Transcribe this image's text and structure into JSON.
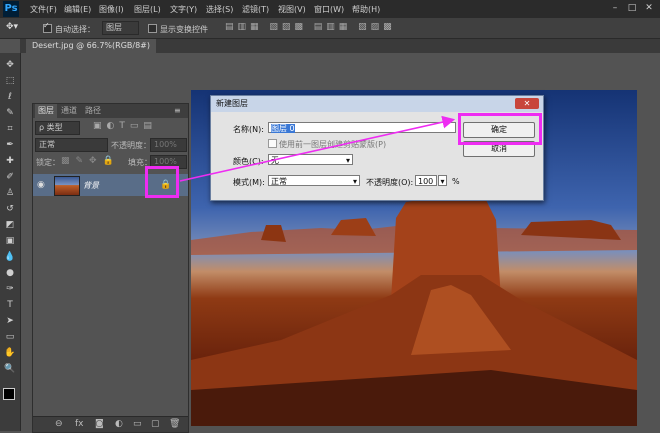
{
  "app": {
    "logo": "Ps"
  },
  "menu": [
    "文件(F)",
    "编辑(E)",
    "图像(I)",
    "图层(L)",
    "文字(Y)",
    "选择(S)",
    "滤镜(T)",
    "视图(V)",
    "窗口(W)",
    "帮助(H)"
  ],
  "options_bar": {
    "auto_select_label": "自动选择：",
    "auto_select_value": "图层",
    "show_transform_label": "显示变换控件"
  },
  "document": {
    "tab": "Desert.jpg @ 66.7%(RGB/8#)"
  },
  "layers_panel": {
    "tabs": [
      "图层",
      "通道",
      "路径"
    ],
    "kind_filter": "ρ 类型",
    "blend_mode": "正常",
    "opacity_label": "不透明度：",
    "opacity_value": "100%",
    "lock_label": "锁定：",
    "fill_label": "填充：",
    "fill_value": "100%",
    "layer_name": "背景"
  },
  "dialog": {
    "title": "新建图层",
    "name_label": "名称(N):",
    "name_value": "图层 0",
    "clip_label": "使用前一图层创建剪贴蒙版(P)",
    "color_label": "颜色(C):",
    "color_value": "无",
    "mode_label": "模式(M):",
    "mode_value": "正常",
    "opacity_label": "不透明度(O):",
    "opacity_value": "100",
    "opacity_unit": "%",
    "ok_label": "确定",
    "cancel_label": "取消"
  },
  "colors": {
    "highlight": "#ee2cf2",
    "layer_selected": "#596d88"
  }
}
